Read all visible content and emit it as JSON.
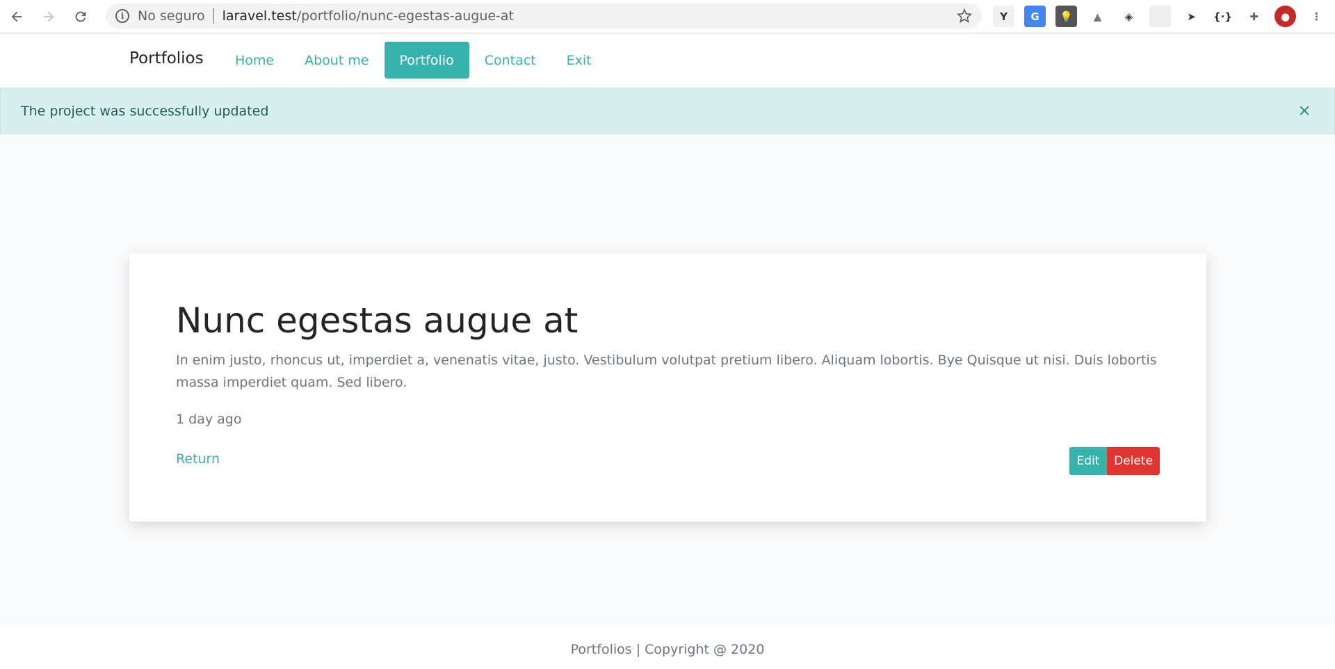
{
  "browser": {
    "security_label": "No seguro",
    "url_host": "laravel.test",
    "url_path": "/portfolio/nunc-egestas-augue-at",
    "extensions": [
      {
        "icon": "y-extension-icon",
        "glyph": "Y",
        "color": "#333333",
        "bg": "#f1f1f1"
      },
      {
        "icon": "google-translate-icon",
        "glyph": "G",
        "color": "#ffffff",
        "bg": "#4285f4"
      },
      {
        "icon": "lightbulb-extension-icon",
        "glyph": "💡",
        "color": "#ffffff",
        "bg": "#555555"
      },
      {
        "icon": "google-drive-icon",
        "glyph": "▲",
        "color": "#777777",
        "bg": "#ffffff"
      },
      {
        "icon": "shield-extension-icon",
        "glyph": "◈",
        "color": "#333333",
        "bg": "#ffffff"
      },
      {
        "icon": "blank-extension-icon",
        "glyph": "",
        "color": "#cccccc",
        "bg": "#eeeeee"
      },
      {
        "icon": "send-icon",
        "glyph": "➤",
        "color": "#333333",
        "bg": "#ffffff"
      },
      {
        "icon": "code-extension-icon",
        "glyph": "{·}",
        "color": "#333333",
        "bg": "#ffffff"
      },
      {
        "icon": "puzzle-icon",
        "glyph": "✚",
        "color": "#5f6368",
        "bg": "#ffffff"
      },
      {
        "icon": "profile-avatar-icon",
        "glyph": "●",
        "color": "#ffffff",
        "bg": "#c62828"
      },
      {
        "icon": "menu-kebab-icon",
        "glyph": "⋮",
        "color": "#5f6368",
        "bg": "#ffffff"
      }
    ]
  },
  "navbar": {
    "brand": "Portfolios",
    "links": [
      {
        "label": "Home",
        "active": false
      },
      {
        "label": "About me",
        "active": false
      },
      {
        "label": "Portfolio",
        "active": true
      },
      {
        "label": "Contact",
        "active": false
      },
      {
        "label": "Exit",
        "active": false
      }
    ]
  },
  "alert": {
    "message": "The project was successfully updated"
  },
  "project": {
    "title": "Nunc egestas augue at",
    "description": "In enim justo, rhoncus ut, imperdiet a, venenatis vitae, justo. Vestibulum volutpat pretium libero. Aliquam lobortis. Bye Quisque ut nisi. Duis lobortis massa imperdiet quam. Sed libero.",
    "time_ago": "1 day ago",
    "return_label": "Return",
    "edit_label": "Edit",
    "delete_label": "Delete"
  },
  "footer": {
    "text": "Portfolios | Copyright @ 2020"
  },
  "colors": {
    "accent": "#38b2ac",
    "danger": "#e3342f",
    "alert_bg": "#d7f0ee"
  }
}
